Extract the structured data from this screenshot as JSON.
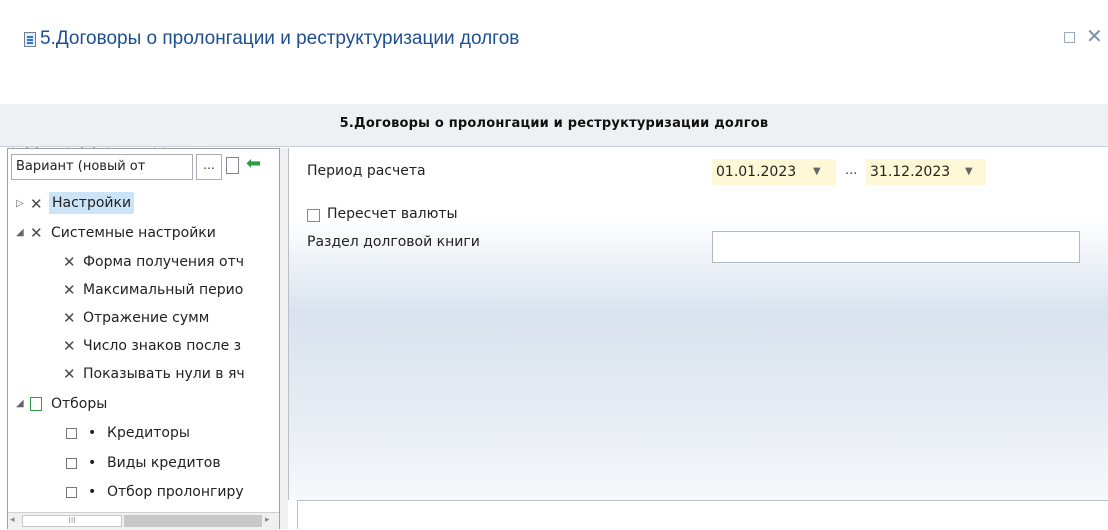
{
  "window": {
    "title": "5.Договоры о пролонгации и реструктуризации долгов",
    "maximize_glyph": "□",
    "close_glyph": "✕"
  },
  "toolbar": {
    "items": [
      "print-icon",
      "dropdown-arrow",
      "preview-icon",
      "settings-gear-icon",
      "dropdown-arrow",
      "tools-icon"
    ]
  },
  "report": {
    "header_title": "5.Договоры о пролонгации и реструктуризации долгов"
  },
  "left_panel": {
    "variant_value": "Вариант (новый от",
    "variant_button": "...",
    "tree": {
      "settings": "Настройки",
      "system_settings": "Системные настройки",
      "system_items": [
        "Форма получения отч",
        "Максимальный перио",
        "Отражение сумм",
        "Число знаков после з",
        "Показывать нули в яч"
      ],
      "filters": "Отборы",
      "filter_items": [
        "Кредиторы",
        "Виды кредитов",
        "Отбор пролонгиру"
      ]
    },
    "scroll_thumb": "III"
  },
  "params": {
    "period_label": "Период расчета",
    "date_from": "01.01.2023",
    "range_sep": "...",
    "date_to": "31.12.2023",
    "currency_recalc_label": "Пересчет валюты",
    "currency_recalc_checked": false,
    "debt_book_label": "Раздел долговой книги",
    "debt_book_value": ""
  },
  "colors": {
    "title": "#1f4f8f",
    "date_highlight": "#fff8d6",
    "selection": "#cce4f7",
    "accent_green": "#2f9f47"
  }
}
